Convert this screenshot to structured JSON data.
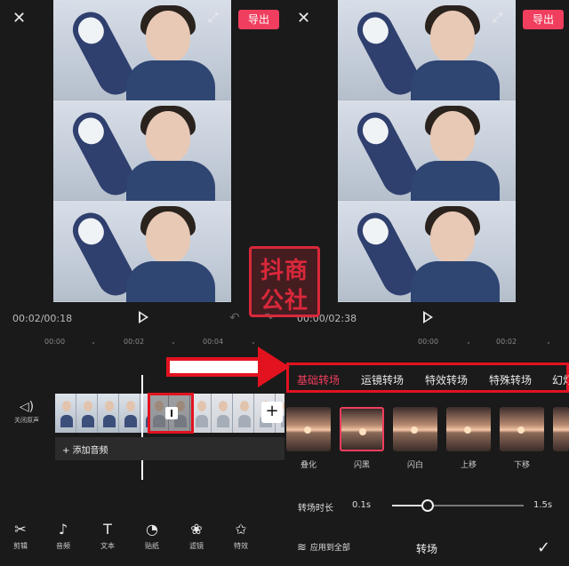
{
  "left": {
    "export_label": "导出",
    "timecode": "00:02/00:18",
    "ruler": [
      "00:00",
      "00:02",
      "00:04"
    ],
    "mute_label": "关闭原声",
    "add_audio": "+ 添加音频",
    "tools": [
      {
        "icon": "scissors-icon",
        "glyph": "✂",
        "label": "剪辑"
      },
      {
        "icon": "music-note-icon",
        "glyph": "♪",
        "label": "音频"
      },
      {
        "icon": "text-icon",
        "glyph": "T",
        "label": "文本"
      },
      {
        "icon": "sticker-icon",
        "glyph": "◔",
        "label": "贴纸"
      },
      {
        "icon": "filter-icon",
        "glyph": "❀",
        "label": "滤镜"
      },
      {
        "icon": "effects-icon",
        "glyph": "✩",
        "label": "特效"
      }
    ]
  },
  "right": {
    "export_label": "导出",
    "timecode": "00:00/02:38",
    "ruler": [
      "00:00",
      "00:02"
    ],
    "tabs": [
      "基础转场",
      "运镜转场",
      "特效转场",
      "特殊转场",
      "幻灯"
    ],
    "active_tab": 0,
    "transitions": [
      "叠化",
      "闪黑",
      "闪白",
      "上移",
      "下移"
    ],
    "selected_transition": 1,
    "duration_label": "转场时长",
    "duration_min": "0.1s",
    "duration_max": "1.5s",
    "duration_fraction": 0.27,
    "apply_all": "应用到全部",
    "panel_title": "转场"
  },
  "watermark": {
    "line1": "抖商",
    "line2": "公社"
  },
  "colors": {
    "accent": "#f03e5e",
    "highlight": "#e3121f",
    "background": "#1a1a1a"
  }
}
